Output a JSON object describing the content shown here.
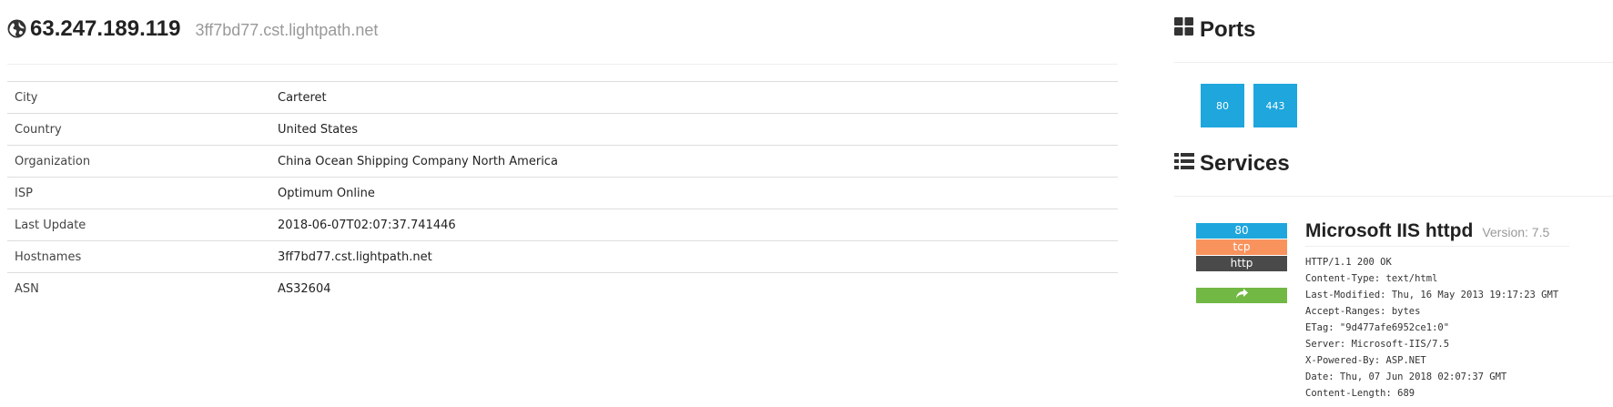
{
  "host": {
    "ip": "63.247.189.119",
    "hostname": "3ff7bd77.cst.lightpath.net"
  },
  "details": [
    {
      "key": "City",
      "value": "Carteret"
    },
    {
      "key": "Country",
      "value": "United States"
    },
    {
      "key": "Organization",
      "value": "China Ocean Shipping Company North America"
    },
    {
      "key": "ISP",
      "value": "Optimum Online"
    },
    {
      "key": "Last Update",
      "value": "2018-06-07T02:07:37.741446"
    },
    {
      "key": "Hostnames",
      "value": "3ff7bd77.cst.lightpath.net"
    },
    {
      "key": "ASN",
      "value": "AS32604"
    }
  ],
  "ports": {
    "title": "Ports",
    "icon": "th-large-icon",
    "items": [
      "80",
      "443"
    ]
  },
  "services": {
    "title": "Services",
    "icon": "list-icon",
    "items": [
      {
        "port": "80",
        "transport": "tcp",
        "module": "http",
        "product": "Microsoft IIS httpd",
        "version_label": "Version: 7.5",
        "link_icon": "share-arrow-icon",
        "banner": [
          "HTTP/1.1 200 OK",
          "Content-Type: text/html",
          "Last-Modified: Thu, 16 May 2013 19:17:23 GMT",
          "Accept-Ranges: bytes",
          "ETag: \"9d477afe6952ce1:0\"",
          "Server: Microsoft-IIS/7.5",
          "X-Powered-By: ASP.NET",
          "Date: Thu, 07 Jun 2018 02:07:37 GMT",
          "Content-Length: 689"
        ]
      }
    ]
  },
  "colors": {
    "port_blue": "#1ea6dd",
    "tcp_orange": "#f9935e",
    "module_dark": "#4a4a4a",
    "link_green": "#72b844"
  }
}
